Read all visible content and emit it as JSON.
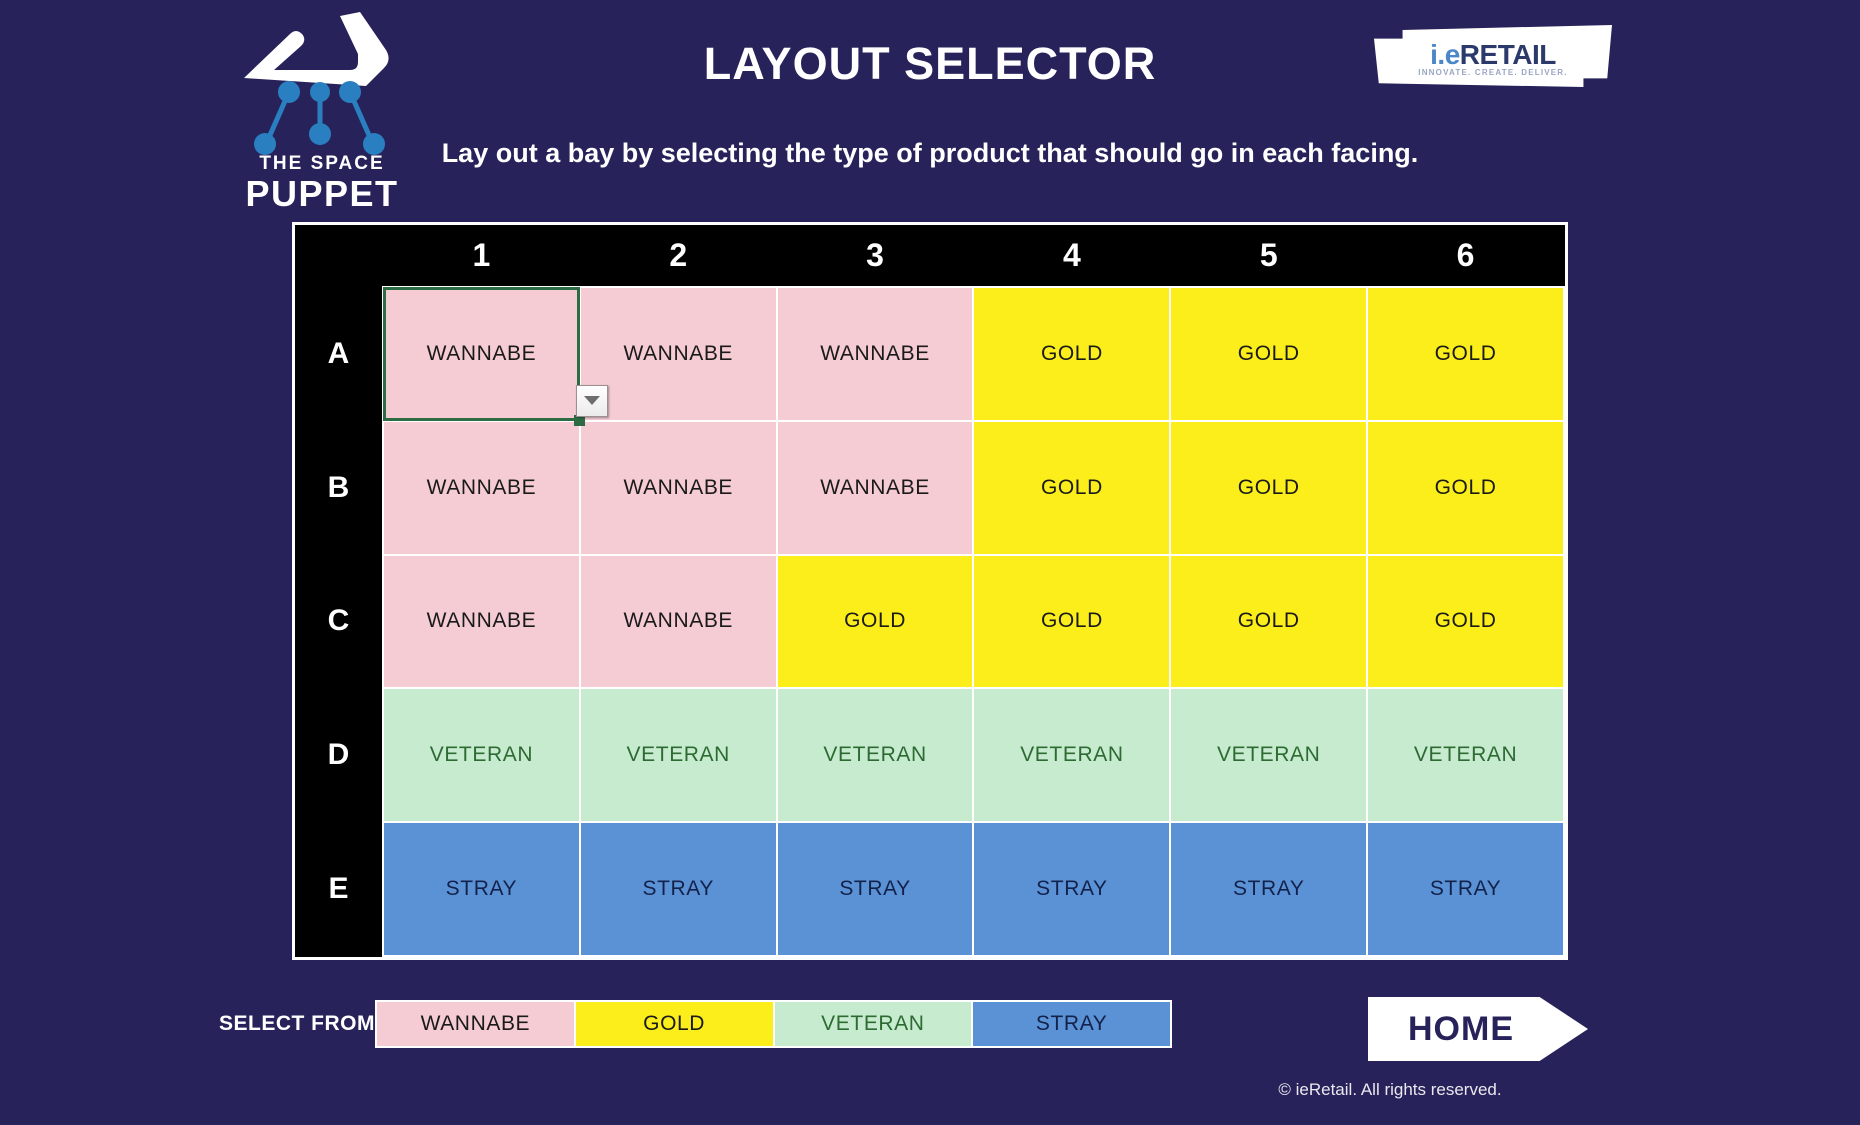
{
  "page": {
    "background_color": "#27235a",
    "title": "LAYOUT SELECTOR",
    "subtitle": "Lay out a bay by selecting the type of product that should go in each facing.",
    "copyright": "© ieRetail. All rights reserved."
  },
  "puppet_logo": {
    "line1": "THE SPACE",
    "line2": "PUPPET",
    "hand_color": "#ffffff",
    "string_color": "#2a7fc1"
  },
  "ieretail_logo": {
    "prefix": "i.e",
    "name": "RETAIL",
    "tagline": "INNOVATE. CREATE. DELIVER."
  },
  "grid": {
    "column_headers": [
      "1",
      "2",
      "3",
      "4",
      "5",
      "6"
    ],
    "row_headers": [
      "A",
      "B",
      "C",
      "D",
      "E"
    ],
    "selected_cell": "A1",
    "rows": [
      {
        "label": "A",
        "cells": [
          {
            "value": "WANNABE",
            "type": "wannabe"
          },
          {
            "value": "WANNABE",
            "type": "wannabe"
          },
          {
            "value": "WANNABE",
            "type": "wannabe"
          },
          {
            "value": "GOLD",
            "type": "gold"
          },
          {
            "value": "GOLD",
            "type": "gold"
          },
          {
            "value": "GOLD",
            "type": "gold"
          }
        ]
      },
      {
        "label": "B",
        "cells": [
          {
            "value": "WANNABE",
            "type": "wannabe"
          },
          {
            "value": "WANNABE",
            "type": "wannabe"
          },
          {
            "value": "WANNABE",
            "type": "wannabe"
          },
          {
            "value": "GOLD",
            "type": "gold"
          },
          {
            "value": "GOLD",
            "type": "gold"
          },
          {
            "value": "GOLD",
            "type": "gold"
          }
        ]
      },
      {
        "label": "C",
        "cells": [
          {
            "value": "WANNABE",
            "type": "wannabe"
          },
          {
            "value": "WANNABE",
            "type": "wannabe"
          },
          {
            "value": "GOLD",
            "type": "gold"
          },
          {
            "value": "GOLD",
            "type": "gold"
          },
          {
            "value": "GOLD",
            "type": "gold"
          },
          {
            "value": "GOLD",
            "type": "gold"
          }
        ]
      },
      {
        "label": "D",
        "cells": [
          {
            "value": "VETERAN",
            "type": "veteran"
          },
          {
            "value": "VETERAN",
            "type": "veteran"
          },
          {
            "value": "VETERAN",
            "type": "veteran"
          },
          {
            "value": "VETERAN",
            "type": "veteran"
          },
          {
            "value": "VETERAN",
            "type": "veteran"
          },
          {
            "value": "VETERAN",
            "type": "veteran"
          }
        ]
      },
      {
        "label": "E",
        "cells": [
          {
            "value": "STRAY",
            "type": "stray"
          },
          {
            "value": "STRAY",
            "type": "stray"
          },
          {
            "value": "STRAY",
            "type": "stray"
          },
          {
            "value": "STRAY",
            "type": "stray"
          },
          {
            "value": "STRAY",
            "type": "stray"
          },
          {
            "value": "STRAY",
            "type": "stray"
          }
        ]
      }
    ]
  },
  "legend": {
    "label": "SELECT FROM",
    "options": [
      {
        "label": "WANNABE",
        "type": "wannabe",
        "color": "#f5ccd4"
      },
      {
        "label": "GOLD",
        "type": "gold",
        "color": "#fbee1b"
      },
      {
        "label": "VETERAN",
        "type": "veteran",
        "color": "#c6ebcf"
      },
      {
        "label": "STRAY",
        "type": "stray",
        "color": "#5b92d6"
      }
    ]
  },
  "home_button": {
    "label": "HOME"
  }
}
